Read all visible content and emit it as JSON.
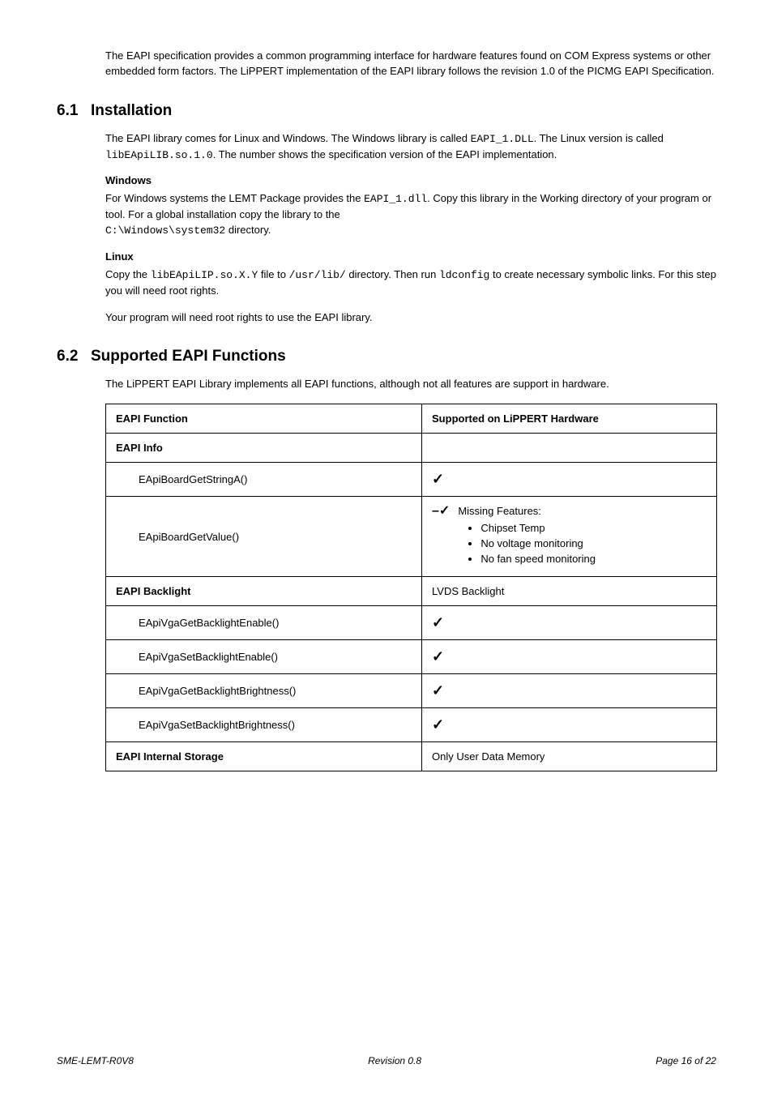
{
  "intro": "The EAPI specification provides a common programming interface for hardware features found on COM Express systems or other embedded form factors. The LiPPERT implementation of the EAPI library follows the revision 1.0 of the PICMG EAPI Specification.",
  "s61": {
    "num": "6.1",
    "title": "Installation",
    "p1a": "The EAPI library comes for Linux and Windows.  The Windows library is called ",
    "p1code1": "EAPI_1.DLL",
    "p1b": ". The Linux version is called ",
    "p1code2": "libEApiLIB.so.1.0",
    "p1c": ". The number shows the specification version of the EAPI implementation.",
    "winHeading": "Windows",
    "winPa": "For Windows systems the LEMT Package provides the ",
    "winCode": "EAPI_1.dll",
    "winPb": ". Copy this library in the Working directory of your program or tool. For a global installation copy the library to the ",
    "winCode2": "C:\\Windows\\system32",
    "winPc": " directory.",
    "linuxHeading": "Linux",
    "linPa": "Copy the ",
    "linCode1": "libEApiLIP.so.X.Y",
    "linPb": " file to ",
    "linCode2": "/usr/lib/",
    "linPc": " directory. Then run ",
    "linCode3": "ldconfig",
    "linPd": " to create necessary symbolic links. For this step you will need root rights.",
    "linP2": "Your program will need root rights to use the EAPI library."
  },
  "s62": {
    "num": "6.2",
    "title": "Supported EAPI Functions",
    "p1": "The LiPPERT EAPI Library implements all EAPI functions, although not all features are support in hardware."
  },
  "table": {
    "h1": "EAPI Function",
    "h2": "Supported on LiPPERT Hardware",
    "groupInfo": "EAPI Info",
    "fn1": "EApiBoardGetStringA()",
    "fn2": "EApiBoardGetValue()",
    "missing": "Missing Features:",
    "m1": "Chipset Temp",
    "m2": "No voltage monitoring",
    "m3": "No fan speed monitoring",
    "groupBacklight": "EAPI Backlight",
    "backlightNote": "LVDS Backlight",
    "fn3": "EApiVgaGetBacklightEnable()",
    "fn4": "EApiVgaSetBacklightEnable()",
    "fn5": "EApiVgaGetBacklightBrightness()",
    "fn6": "EApiVgaSetBacklightBrightness()",
    "groupStorage": "EAPI Internal Storage",
    "storageNote": "Only User Data Memory"
  },
  "check": "✓",
  "dashcheck": "–✓",
  "footer": {
    "left": "SME-LEMT-R0V8",
    "center": "Revision 0.8",
    "right": "Page 16 of 22"
  }
}
